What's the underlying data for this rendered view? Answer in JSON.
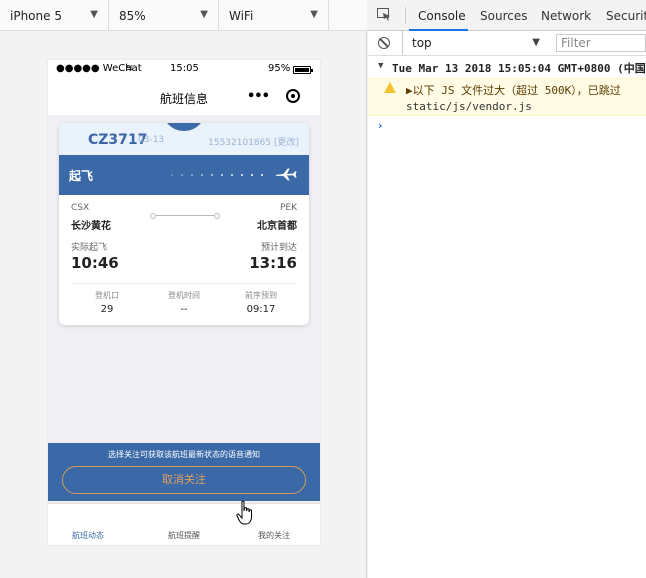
{
  "simulator": {
    "device": "iPhone 5",
    "zoom": "85%",
    "network": "WiFi"
  },
  "phone": {
    "status": {
      "carrier": "●●●●● WeChat",
      "time": "15:05",
      "battery": "95%"
    },
    "nav": {
      "title": "航班信息",
      "more": "•••"
    },
    "flight": {
      "number": "CZ3717",
      "date": "03-13",
      "phone_change": "15532101865 [更改]",
      "status": "起飞",
      "from_code": "CSX",
      "from_city": "长沙黄花",
      "to_code": "PEK",
      "to_city": "北京首都",
      "dep_label": "实际起飞",
      "dep_time": "10:46",
      "arr_label": "预计到达",
      "arr_time": "13:16",
      "gate_label": "登机口",
      "gate_value": "29",
      "board_label": "登机时间",
      "board_value": "--",
      "prev_label": "前序预到",
      "prev_value": "09:17"
    },
    "follow": {
      "tip": "选择关注可获取该航班最新状态的语音通知",
      "button": "取消关注"
    },
    "tabs": [
      "航班动态",
      "航班提醒",
      "我的关注"
    ],
    "accent": "#3b69a8"
  },
  "devtools": {
    "tabs": [
      "Console",
      "Sources",
      "Network",
      "Security"
    ],
    "active_tab": "Console",
    "context": "top",
    "filter_placeholder": "Filter",
    "log_date": "Tue Mar 13 2018 15:05:04 GMT+0800 (中国",
    "warn_line1": "▶以下 JS 文件过大（超过 500K），已跳过",
    "warn_line2": "static/js/vendor.js",
    "prompt": "›"
  }
}
